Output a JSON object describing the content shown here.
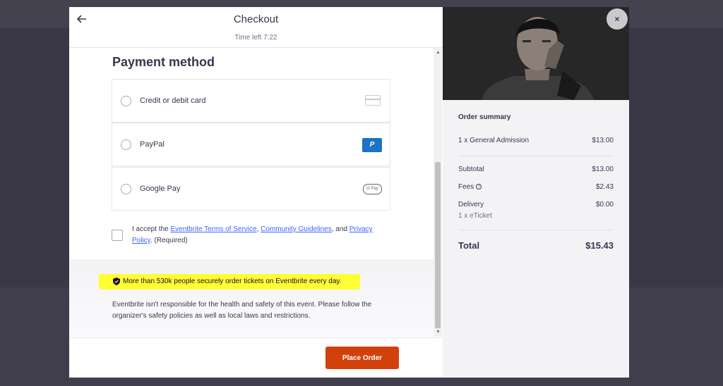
{
  "header": {
    "title": "Checkout",
    "timer": "Time left 7:22",
    "back_icon": "arrow-left-icon"
  },
  "payment": {
    "title": "Payment method",
    "options": [
      {
        "label": "Credit or debit card",
        "icon": "credit-card-icon"
      },
      {
        "label": "PayPal",
        "icon": "paypal-icon",
        "icon_text": "P"
      },
      {
        "label": "Google Pay",
        "icon": "google-pay-icon",
        "icon_text": "G Pay"
      }
    ]
  },
  "terms": {
    "prefix": "I accept the ",
    "tos_link": "Eventbrite Terms of Service",
    "sep1": ", ",
    "guidelines_link": "Community Guidelines",
    "sep2": ", and ",
    "privacy_link": "Privacy Policy",
    "suffix": ". (Required)"
  },
  "info": {
    "highlight": "More than 530k people securely order tickets on Eventbrite every day.",
    "highlight_color": "#ffff33",
    "disclaimer": "Eventbrite isn't responsible for the health and safety of this event. Please follow the organizer's safety policies as well as local laws and restrictions."
  },
  "footer": {
    "place_order": "Place Order",
    "accent": "#d1410c"
  },
  "summary": {
    "title": "Order summary",
    "line_item": {
      "label": "1 x General Admission",
      "amount": "$13.00"
    },
    "subtotal": {
      "label": "Subtotal",
      "amount": "$13.00"
    },
    "fees": {
      "label": "Fees",
      "amount": "$2.43",
      "icon": "info-icon",
      "icon_text": "i"
    },
    "delivery": {
      "label": "Delivery",
      "amount": "$0.00",
      "detail": "1 x eTicket"
    },
    "total": {
      "label": "Total",
      "amount": "$15.43"
    }
  },
  "close_icon": "×"
}
